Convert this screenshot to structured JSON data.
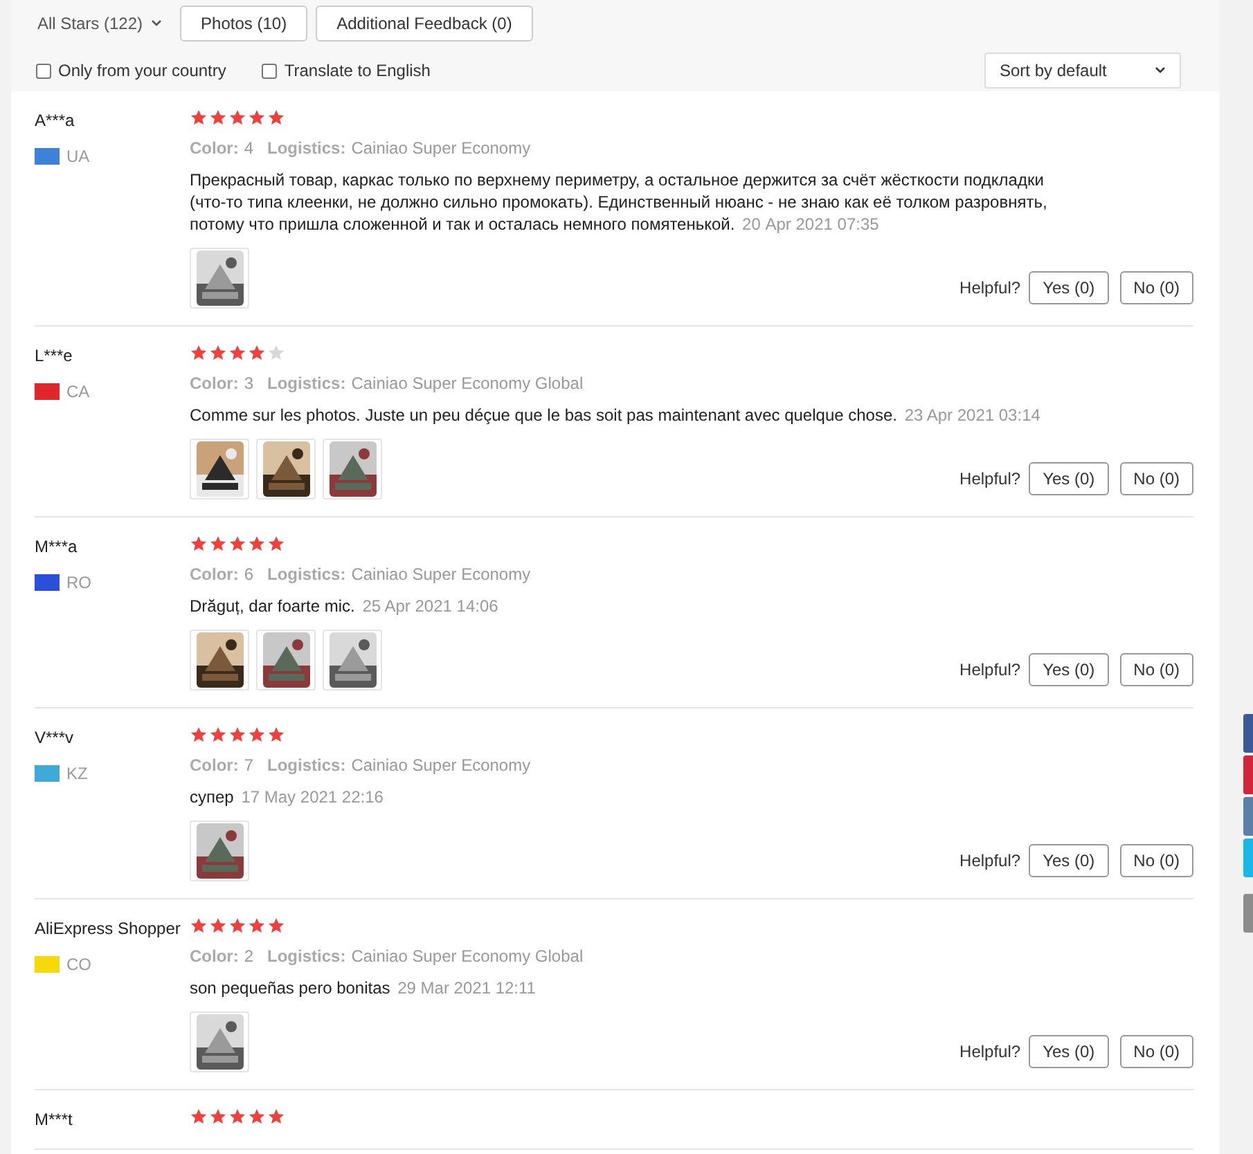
{
  "filters": {
    "stars_dropdown": "All Stars (122)",
    "buttons": [
      {
        "label": "Photos (10)"
      },
      {
        "label": "Additional Feedback (0)"
      }
    ],
    "checkboxes": [
      {
        "label": "Only from your country",
        "checked": false
      },
      {
        "label": "Translate to English",
        "checked": false
      }
    ],
    "sort": "Sort by default"
  },
  "reviews": [
    {
      "name": "A***a",
      "country": "UA",
      "color": "#3b82d8",
      "stars": 5,
      "attributes": [
        {
          "label": "Color:",
          "value": "4"
        },
        {
          "label": "Logistics:",
          "value": "Cainiao Super Economy"
        }
      ],
      "text": "Прекрасный товар, каркас только по верхнему периметру, а остальное держится за счёт жёсткости подкладки (что-то типа клеенки, не должно сильно промокать). Единственный нюанс - не знаю как её толком разровнять, потому что пришла сложенной и так и осталась немного помятенькой.",
      "date": "20 Apr 2021 07:35",
      "photos": [
        {
          "kind": "picture"
        }
      ],
      "helpful": "Helpful?",
      "yes": "Yes (0)",
      "no": "No (0)"
    },
    {
      "name": "L***e",
      "country": "CA",
      "color": "#e0252b",
      "stars": 4,
      "attributes": [
        {
          "label": "Color:",
          "value": "3"
        },
        {
          "label": "Logistics:",
          "value": "Cainiao Super Economy Global"
        }
      ],
      "text": "Comme sur les photos. Juste un peu déçue que le bas soit pas maintenant avec quelque chose.",
      "date": "23 Apr 2021 03:14",
      "photos": [
        {
          "kind": "picture"
        },
        {
          "kind": "picture"
        },
        {
          "kind": "picture"
        }
      ],
      "helpful": "Helpful?",
      "yes": "Yes (0)",
      "no": "No (0)"
    },
    {
      "name": "M***a",
      "country": "RO",
      "color": "#2b4fd8",
      "stars": 5,
      "attributes": [
        {
          "label": "Color:",
          "value": "6"
        },
        {
          "label": "Logistics:",
          "value": "Cainiao Super Economy"
        }
      ],
      "text": "Drăguț, dar foarte mic.",
      "date": "25 Apr 2021 14:06",
      "photos": [
        {
          "kind": "picture"
        },
        {
          "kind": "picture"
        },
        {
          "kind": "picture"
        }
      ],
      "helpful": "Helpful?",
      "yes": "Yes (0)",
      "no": "No (0)"
    },
    {
      "name": "V***v",
      "country": "KZ",
      "color": "#3fa9d8",
      "stars": 5,
      "attributes": [
        {
          "label": "Color:",
          "value": "7"
        },
        {
          "label": "Logistics:",
          "value": "Cainiao Super Economy"
        }
      ],
      "text": "супер",
      "date": "17 May 2021 22:16",
      "photos": [
        {
          "kind": "picture"
        }
      ],
      "helpful": "Helpful?",
      "yes": "Yes (0)",
      "no": "No (0)"
    },
    {
      "name": "AliExpress Shopper",
      "country": "CO",
      "color": "#f5d90a",
      "stars": 5,
      "attributes": [
        {
          "label": "Color:",
          "value": "2"
        },
        {
          "label": "Logistics:",
          "value": "Cainiao Super Economy Global"
        }
      ],
      "text": "son pequeñas pero bonitas",
      "date": "29 Mar 2021 12:11",
      "photos": [
        {
          "kind": "picture"
        }
      ],
      "helpful": "Helpful?",
      "yes": "Yes (0)",
      "no": "No (0)"
    },
    {
      "name": "M***t",
      "stars": 5
    }
  ],
  "share_buttons": [
    {
      "color": "#3b5998"
    },
    {
      "color": "#d0253a"
    },
    {
      "color": "#5b7fa6"
    },
    {
      "color": "#1ab7ea"
    },
    {
      "color": "#8c8c8c"
    }
  ]
}
